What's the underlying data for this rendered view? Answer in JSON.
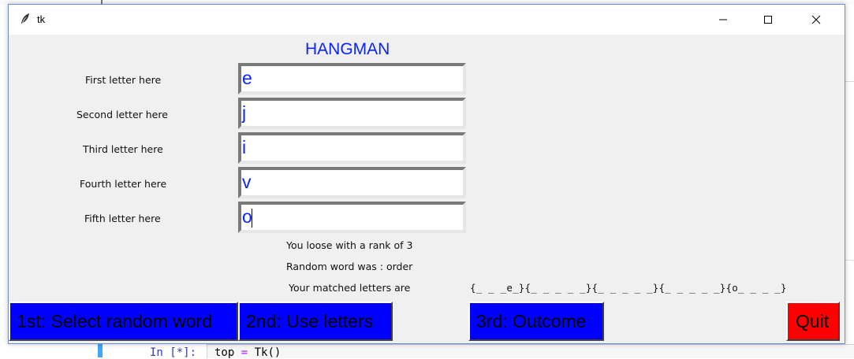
{
  "background": {
    "prompt": "In [*]:",
    "code_var": "top",
    "code_op": "=",
    "code_call": "Tk()"
  },
  "window": {
    "title": "tk",
    "controls": [
      "minimize",
      "maximize",
      "close"
    ]
  },
  "app": {
    "heading": "HANGMAN",
    "rows": [
      {
        "label": "First letter here",
        "value": "e"
      },
      {
        "label": "Second letter here",
        "value": "j"
      },
      {
        "label": "Third letter here",
        "value": "i"
      },
      {
        "label": "Fourth letter here",
        "value": "v"
      },
      {
        "label": "Fifth letter here",
        "value": "o"
      }
    ],
    "result_text": "You loose with a rank of 3",
    "random_word_text": "Random word was : order",
    "matched_label": "Your matched letters are",
    "matched_value": "{_ _ _e_}{_ _ _ _ _}{_ _ _ _ _}{_ _ _ _ _}{o_ _ _ _}",
    "buttons": {
      "select_word": "1st: Select random word",
      "use_letters": "2nd: Use letters",
      "outcome": "3rd: Outcome",
      "quit": "Quit"
    }
  },
  "colors": {
    "accent_blue": "#0000ff",
    "text_blue": "#0a24ff",
    "quit_red": "#ff0000"
  }
}
